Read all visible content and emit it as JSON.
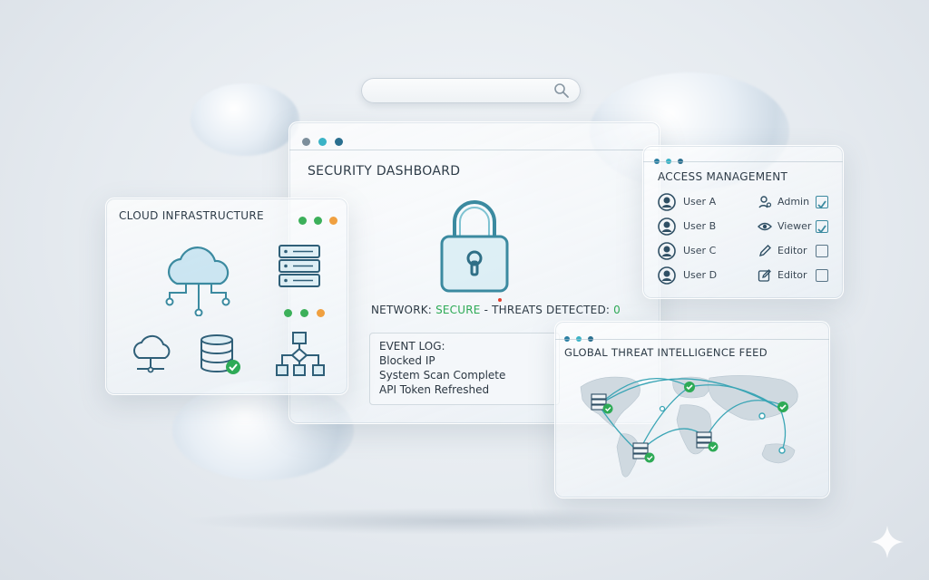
{
  "search": {
    "placeholder": ""
  },
  "security_dashboard": {
    "title": "SECURITY DASHBOARD",
    "status_prefix": "NETWORK: ",
    "status_value": "SECURE",
    "status_sep": " - ",
    "threats_label": "THREATS DETECTED: ",
    "threats_value": "0",
    "event_log": {
      "heading": "EVENT LOG:",
      "entries": [
        "Blocked IP",
        "System Scan Complete",
        "API Token Refreshed"
      ]
    }
  },
  "cloud_infrastructure": {
    "title": "CLOUD INFRASTRUCTURE"
  },
  "access_management": {
    "title": "ACCESS MANAGEMENT",
    "users": [
      {
        "name": "User A",
        "role": "Admin",
        "role_icon": "admin-user-icon",
        "checked": true
      },
      {
        "name": "User B",
        "role": "Viewer",
        "role_icon": "eye-icon",
        "checked": true
      },
      {
        "name": "User C",
        "role": "Editor",
        "role_icon": "pencil-icon",
        "checked": false
      },
      {
        "name": "User D",
        "role": "Editor",
        "role_icon": "edit-icon",
        "checked": false
      }
    ]
  },
  "threat_feed": {
    "title": "GLOBAL THREAT INTELLIGENCE FEED"
  },
  "colors": {
    "accent": "#2f7f96",
    "secure": "#2eaa56",
    "dot_blue": "#2a7fa2",
    "dot_teal": "#3ab3c6",
    "dot_gray": "#7d8f9c",
    "dot_green": "#3cb05a",
    "dot_orange": "#f0a040",
    "alert_red": "#e3402f"
  }
}
